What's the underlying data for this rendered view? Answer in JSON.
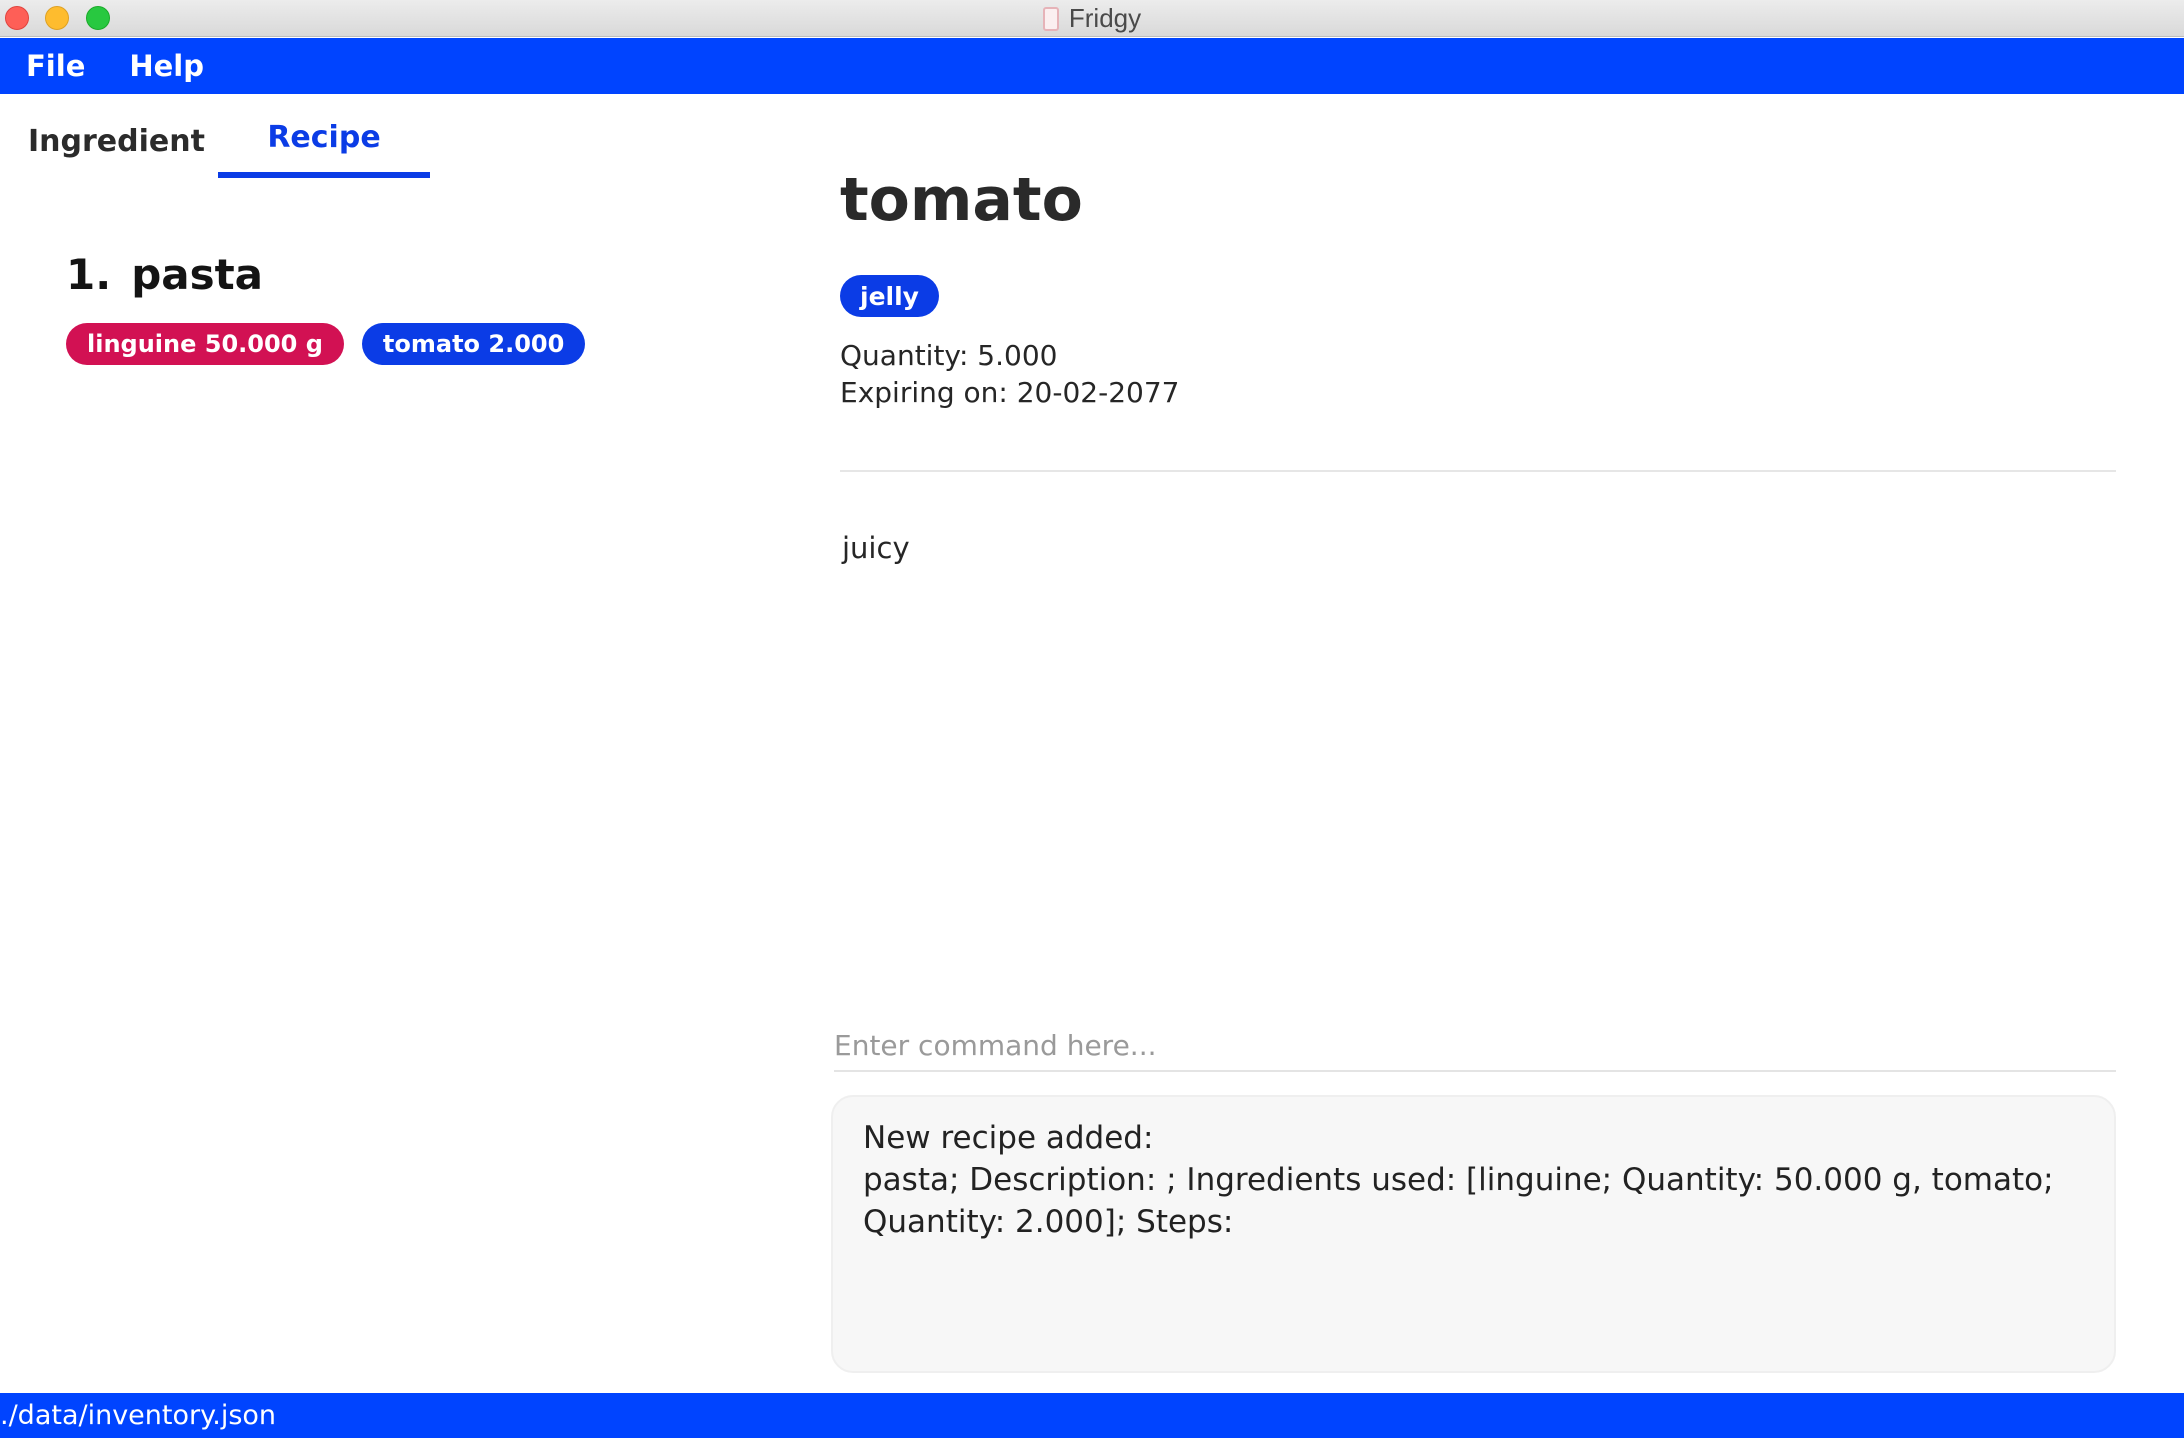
{
  "window": {
    "title": "Fridgy",
    "app_icon": "fridge-icon"
  },
  "menu": {
    "items": [
      {
        "label": "File"
      },
      {
        "label": "Help"
      }
    ]
  },
  "tabs": [
    {
      "label": "Ingredient",
      "active": false
    },
    {
      "label": "Recipe",
      "active": true
    }
  ],
  "recipe_list": [
    {
      "index": "1.",
      "name": "pasta",
      "ingredients": [
        {
          "label": "linguine 50.000 g",
          "color": "#d21153"
        },
        {
          "label": "tomato 2.000",
          "color": "#0b3ce6"
        }
      ]
    }
  ],
  "detail": {
    "title": "tomato",
    "tag": "jelly",
    "quantity": "Quantity: 5.000",
    "expiry": "Expiring on: 20-02-2077",
    "description": "juicy"
  },
  "command": {
    "placeholder": "Enter command here...",
    "value": ""
  },
  "result": {
    "text": "New recipe added:\npasta; Description: ; Ingredients used: [linguine; Quantity: 50.000 g, tomato;\nQuantity: 2.000]; Steps:"
  },
  "status": {
    "path": "./data/inventory.json"
  },
  "colors": {
    "accent": "#0044ff",
    "tab_active": "#0b3ce6",
    "chip_red": "#d21153",
    "chip_blue": "#0b3ce6"
  }
}
